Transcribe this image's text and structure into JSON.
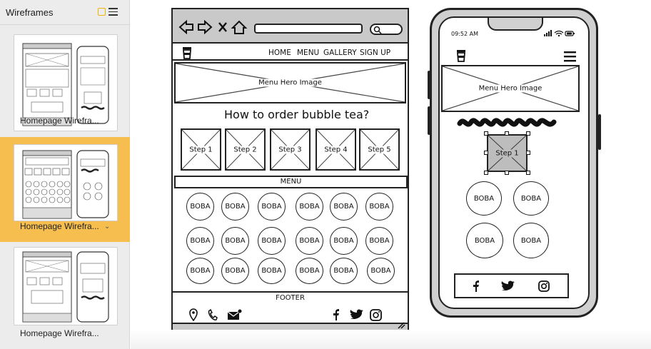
{
  "sidebar": {
    "title": "Wireframes",
    "cards": [
      {
        "label": "Homepage Wirefra...",
        "selected": false
      },
      {
        "label": "Homepage Wirefra...",
        "selected": true
      },
      {
        "label": "Homepage Wirefra...",
        "selected": false
      }
    ]
  },
  "desktop": {
    "nav": [
      "HOME",
      "MENU",
      "GALLERY",
      "SIGN UP"
    ],
    "hero_label": "Menu Hero Image",
    "heading": "How to order bubble tea?",
    "steps": [
      "Step 1",
      "Step 2",
      "Step 3",
      "Step 4",
      "Step 5"
    ],
    "menu_label": "MENU",
    "boba_label": "BOBA",
    "footer_label": "FOOTER"
  },
  "mobile": {
    "time": "09:52 AM",
    "hero_label": "Menu Hero Image",
    "step_label": "Step 1",
    "boba_label": "BOBA"
  },
  "icons": {
    "browser": [
      "back-arrow-icon",
      "forward-arrow-icon",
      "close-icon",
      "home-icon",
      "search-icon"
    ],
    "footer": [
      "location-pin-icon",
      "phone-icon",
      "mail-icon",
      "facebook-icon",
      "twitter-icon",
      "instagram-icon"
    ]
  },
  "colors": {
    "selection": "#f6be4f",
    "sidebar_bg": "#ececec",
    "browser_bar": "#c9c9c9",
    "phone_frame": "#d0d0d0"
  }
}
